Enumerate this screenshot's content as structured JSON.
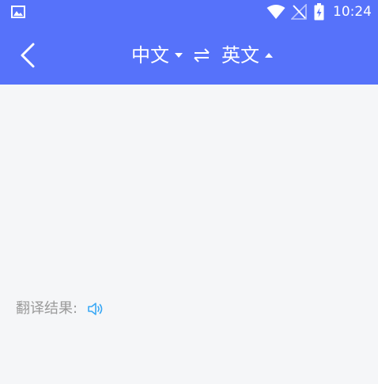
{
  "status_bar": {
    "time": "10:24",
    "icons": [
      "gallery-icon",
      "wifi-icon",
      "no-signal-icon",
      "battery-charging-icon"
    ]
  },
  "header": {
    "source_language": "中文",
    "target_language": "英文",
    "icons": [
      "back-arrow-icon",
      "caret-down-icon",
      "swap-icon",
      "caret-up-icon"
    ]
  },
  "result": {
    "label": "翻译结果:",
    "icon": "speaker-icon"
  },
  "colors": {
    "header": "#5672fa",
    "background": "#f5f6f8",
    "label": "#9a9a9a",
    "accent": "#3aa8f5"
  }
}
